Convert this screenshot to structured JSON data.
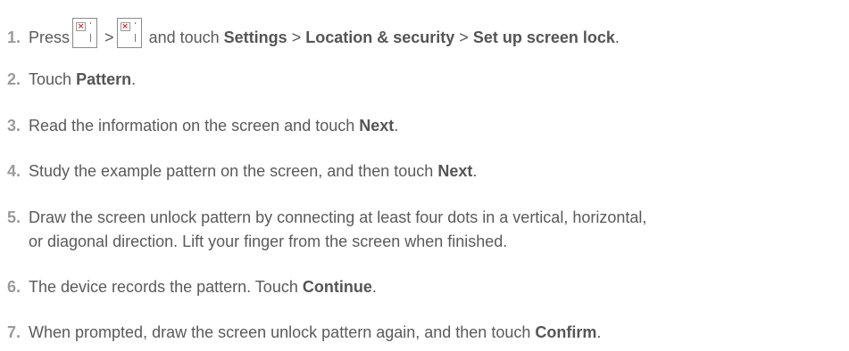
{
  "steps": [
    {
      "number": "1.",
      "parts": {
        "t1": "Press",
        "sep1": ">",
        "t2": "and touch",
        "b1": "Settings",
        "sep2": ">",
        "b2": "Location & security",
        "sep3": ">",
        "b3": "Set up screen lock",
        "end": "."
      },
      "icons": [
        "menu-icon",
        "menu-icon"
      ]
    },
    {
      "number": "2.",
      "parts": {
        "t1": "Touch",
        "b1": "Pattern",
        "end": "."
      }
    },
    {
      "number": "3.",
      "parts": {
        "t1": "Read the information on the screen and touch",
        "b1": "Next",
        "end": "."
      }
    },
    {
      "number": "4.",
      "parts": {
        "t1": "Study the example pattern on the screen, and then touch",
        "b1": "Next",
        "end": "."
      }
    },
    {
      "number": "5.",
      "parts": {
        "line1": "Draw the screen unlock pattern by connecting at least four dots in a vertical, horizontal,",
        "line2": "or diagonal direction. Lift your finger from the screen when finished."
      }
    },
    {
      "number": "6.",
      "parts": {
        "t1": "The device records the pattern. Touch",
        "b1": "Continue",
        "end": "."
      }
    },
    {
      "number": "7.",
      "parts": {
        "t1": "When prompted, draw the screen unlock pattern again, and then touch",
        "b1": "Confirm",
        "end": "."
      }
    }
  ]
}
